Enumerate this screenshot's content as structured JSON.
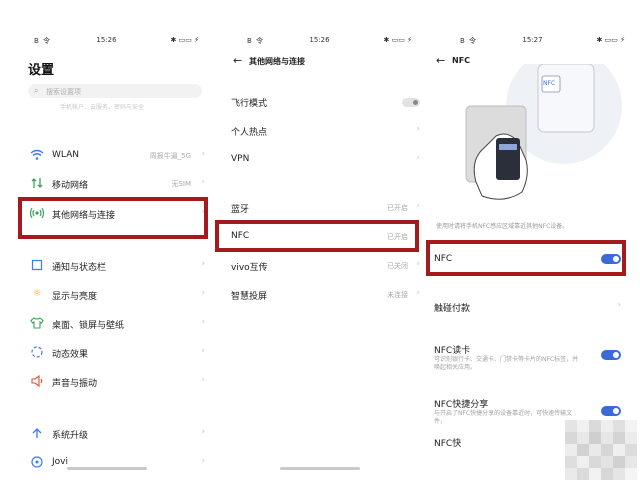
{
  "panel1": {
    "status": {
      "left": "B 令",
      "time": "15:26",
      "right": "✱ ▭▭ ⚡"
    },
    "title": "设置",
    "search_placeholder": "搜索设置项",
    "faded_text": "手机帐户、云服务、密码与安全",
    "items": [
      {
        "label": "WLAN",
        "value": "周报牛逼_5G",
        "icon": "wifi-icon"
      },
      {
        "label": "移动网络",
        "value": "无SIM",
        "icon": "signal-icon"
      },
      {
        "label": "其他网络与连接",
        "value": "",
        "icon": "nfc-radio-icon"
      },
      {
        "label": "通知与状态栏",
        "value": "",
        "icon": "notification-icon"
      },
      {
        "label": "显示与亮度",
        "value": "",
        "icon": "brightness-icon"
      },
      {
        "label": "桌面、锁屏与壁纸",
        "value": "",
        "icon": "shirt-icon"
      },
      {
        "label": "动态效果",
        "value": "",
        "icon": "animation-icon"
      },
      {
        "label": "声音与振动",
        "value": "",
        "icon": "speaker-icon"
      },
      {
        "label": "系统升级",
        "value": "",
        "icon": "upgrade-icon"
      },
      {
        "label": "Jovi",
        "value": "",
        "icon": "jovi-icon"
      }
    ]
  },
  "panel2": {
    "status": {
      "left": "B 令",
      "time": "15:26",
      "right": "✱ ▭▭ ⚡"
    },
    "title": "其他网络与连接",
    "items": [
      {
        "label": "飞行模式",
        "value": ""
      },
      {
        "label": "个人热点",
        "value": ""
      },
      {
        "label": "VPN",
        "value": ""
      },
      {
        "label": "蓝牙",
        "value": "已开启"
      },
      {
        "label": "NFC",
        "value": "已开启"
      },
      {
        "label": "vivo互传",
        "value": "已关闭"
      },
      {
        "label": "智慧投屏",
        "value": "未连接"
      }
    ]
  },
  "panel3": {
    "status": {
      "left": "B 令",
      "time": "15:27",
      "right": "✱ ▭▭ ⚡"
    },
    "title": "NFC",
    "nfc_badge": "NFC",
    "description": "使用时请将手机NFC感应区域靠近其他NFC设备。",
    "items": [
      {
        "label": "NFC",
        "sub": "",
        "toggle": true
      },
      {
        "label": "触碰付款",
        "sub": "",
        "toggle": false
      },
      {
        "label": "NFC读卡",
        "sub": "可识别银行卡、交通卡、门禁卡等卡片的NFC标签，并唤起相关应用。",
        "toggle": true
      },
      {
        "label": "NFC快捷分享",
        "sub": "与开启了NFC快捷分享的设备靠近时，可快速传输文件，",
        "toggle": true
      },
      {
        "label": "NFC快",
        "sub": "",
        "toggle": false
      }
    ]
  },
  "colors": {
    "accent": "#3a6bd9",
    "highlight_box": "#a31a1f",
    "icon_blue": "#3a7bff"
  }
}
